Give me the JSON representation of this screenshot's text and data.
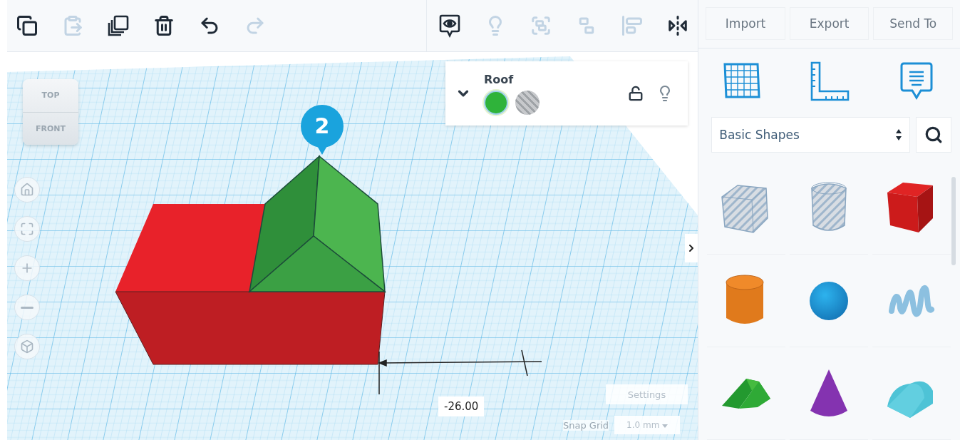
{
  "toolbar": {
    "edit_tools": [
      {
        "kind": "copy",
        "disabled": false
      },
      {
        "kind": "paste",
        "disabled": true
      },
      {
        "kind": "duplicate",
        "disabled": false
      },
      {
        "kind": "delete",
        "disabled": false
      },
      {
        "kind": "undo",
        "disabled": false
      },
      {
        "kind": "redo",
        "disabled": true
      }
    ],
    "view_tools": [
      {
        "kind": "notes",
        "disabled": false
      },
      {
        "kind": "light",
        "disabled": true
      },
      {
        "kind": "group",
        "disabled": true
      },
      {
        "kind": "ungroup",
        "disabled": true
      },
      {
        "kind": "align",
        "disabled": true
      },
      {
        "kind": "mirror",
        "disabled": false
      }
    ]
  },
  "view_cube": {
    "top": "TOP",
    "front": "FRONT"
  },
  "nav_buttons": [
    {
      "kind": "home"
    },
    {
      "kind": "fit"
    },
    {
      "kind": "zoom_in"
    },
    {
      "kind": "zoom_out"
    },
    {
      "kind": "ortho"
    }
  ],
  "callout": "2",
  "inspector": {
    "name": "Roof",
    "locked": false,
    "swatches": [
      {
        "kind": "solid",
        "selected": true
      },
      {
        "kind": "hole",
        "selected": false
      }
    ]
  },
  "dimension": "-26.00",
  "settings": "Settings",
  "snap_grid": {
    "label": "Snap Grid",
    "value": "1.0 mm"
  },
  "panel": {
    "actions": [
      "Import",
      "Export",
      "Send To"
    ],
    "tools": [
      {
        "kind": "workplane"
      },
      {
        "kind": "ruler"
      },
      {
        "kind": "notes"
      }
    ],
    "library": "Basic Shapes",
    "shapes": [
      {
        "kind": "box_hole"
      },
      {
        "kind": "cylinder_hole"
      },
      {
        "kind": "box"
      },
      {
        "kind": "cylinder"
      },
      {
        "kind": "sphere"
      },
      {
        "kind": "scribble"
      },
      {
        "kind": "roof"
      },
      {
        "kind": "cone"
      },
      {
        "kind": "round_roof"
      }
    ]
  }
}
